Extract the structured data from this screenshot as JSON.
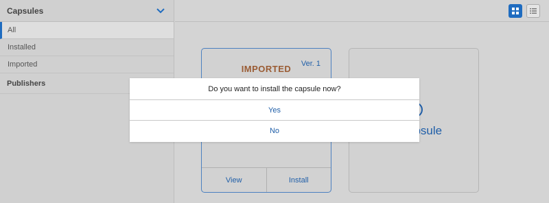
{
  "sidebar": {
    "title": "Capsules",
    "items": [
      {
        "label": "All"
      },
      {
        "label": "Installed"
      },
      {
        "label": "Imported"
      }
    ],
    "section": "Publishers"
  },
  "toolbar": {
    "grid_icon": "grid-view-icon",
    "list_icon": "list-view-icon"
  },
  "cards": {
    "imported": {
      "title": "IMPORTED",
      "version": "Ver. 1",
      "view_label": "View",
      "install_label": "Install"
    },
    "add": {
      "label_partial": "apsule"
    }
  },
  "dialog": {
    "message": "Do you want to install the capsule now?",
    "yes_label": "Yes",
    "no_label": "No"
  },
  "colors": {
    "accent": "#1f6cc0",
    "imported_title": "#9a5c34"
  }
}
